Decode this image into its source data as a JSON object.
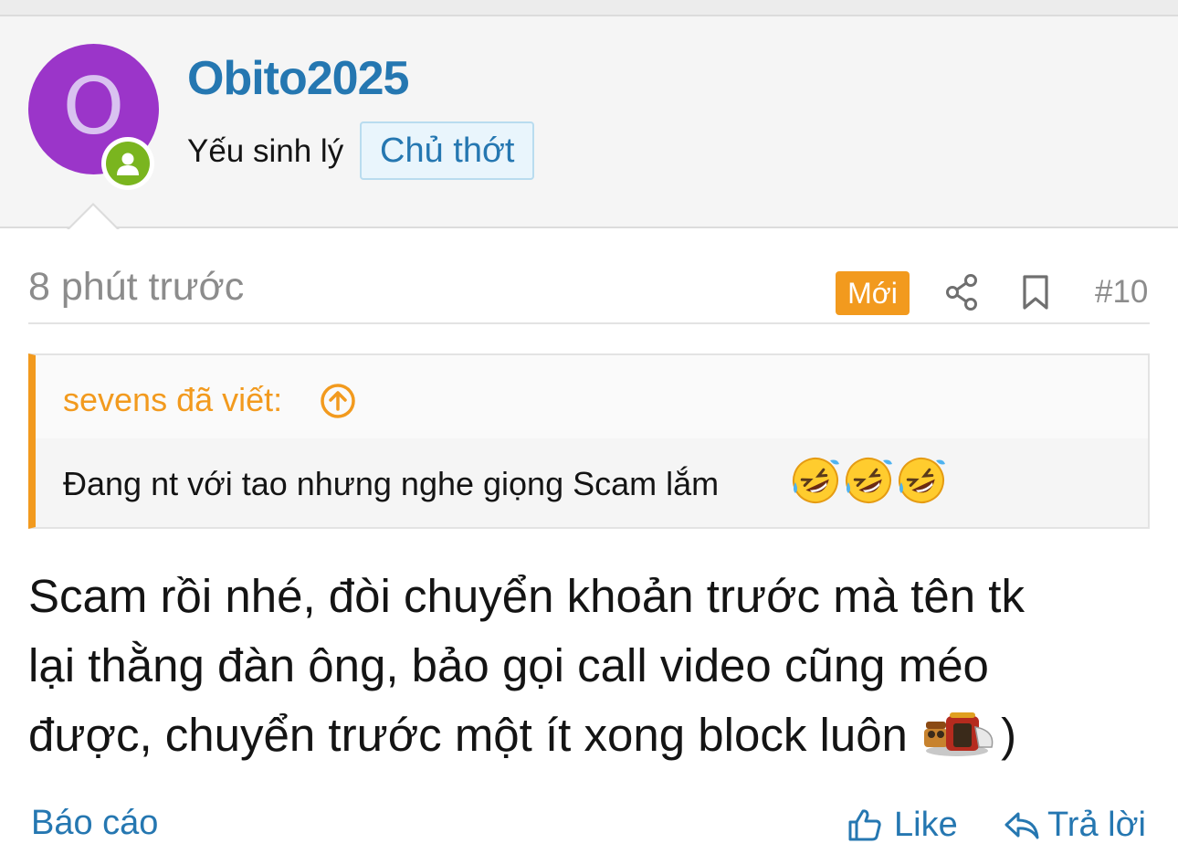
{
  "user": {
    "avatar_letter": "O",
    "username": "Obito2025",
    "title": "Yếu sinh lý",
    "op_badge": "Chủ thớt",
    "avatar_color": "#9b35c9",
    "online_color": "#7ab51f"
  },
  "post": {
    "time": "8 phút trước",
    "new_badge": "Mới",
    "number": "#10",
    "share_icon": "share-icon",
    "bookmark_icon": "bookmark-icon"
  },
  "quote": {
    "author": "sevens đã viết:",
    "text": "Đang nt với tao nhưng nghe giọng Scam lắm",
    "emojis": [
      "rolling-on-floor-laughing",
      "rolling-on-floor-laughing",
      "rolling-on-floor-laughing"
    ]
  },
  "message": {
    "line1": "Scam rồi nhé, đòi chuyển khoản trước mà tên tk",
    "line2": "lại thằng đàn ông, bảo gọi call video cũng méo",
    "line3": "được, chuyển trước một ít xong block luôn",
    "line3_tail": ")"
  },
  "actions": {
    "report": "Báo cáo",
    "like": "Like",
    "reply": "Trả lời"
  },
  "colors": {
    "link": "#2577b1",
    "accent": "#f29a1e",
    "muted": "#8c8c8c"
  }
}
